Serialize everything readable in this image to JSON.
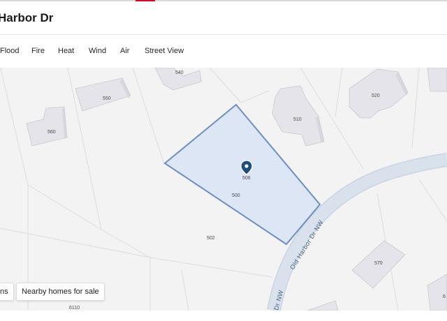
{
  "header": {
    "title": "Harbor Dr"
  },
  "tabs": [
    {
      "label": "Flood"
    },
    {
      "label": "Fire"
    },
    {
      "label": "Heat"
    },
    {
      "label": "Wind"
    },
    {
      "label": "Air"
    },
    {
      "label": "Street View"
    }
  ],
  "map": {
    "parcel_labels": [
      "540",
      "550",
      "560",
      "510",
      "520",
      "506",
      "500",
      "502",
      "570",
      "6110",
      "6"
    ],
    "road_name": "Old Harbor Dr NW",
    "road_name_lower": "Dr NW",
    "pin_icon": "location-pin-icon",
    "colors": {
      "parcel_fill": "#dde6f5",
      "parcel_stroke": "#6e8fbd",
      "road": "#c9d5e3",
      "building": "#e4e4ea",
      "pin": "#1c4f7c"
    }
  },
  "chips": [
    {
      "label": "ns"
    },
    {
      "label": "Nearby homes for sale"
    }
  ]
}
